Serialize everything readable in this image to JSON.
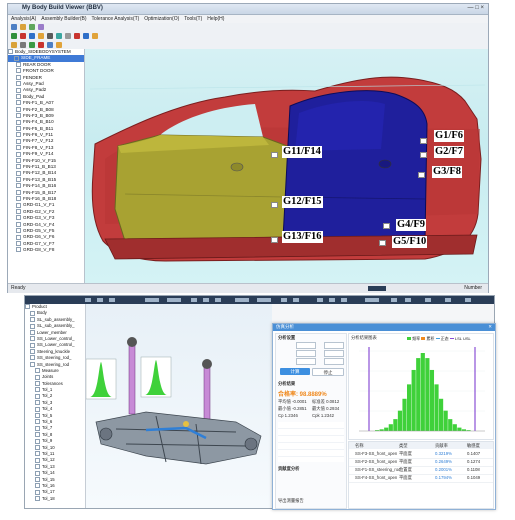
{
  "top_window": {
    "title": "My Body Build Viewer (BBV)",
    "window_controls": "— □ ×",
    "menu": [
      "Analysis(A)",
      "Assembly Builder(B)",
      "Tolerance Analysis(T)",
      "Optimization(O)",
      "Tools(T)",
      "Help(H)"
    ],
    "tree": {
      "root": "Body_SIDEBODYSYSTEM",
      "selected": "SIDE_FRAME",
      "items": [
        "REAR DOOR",
        "FRONT DOOR",
        "FENDER",
        "Assy_Pad",
        "Assy_Pad2",
        "Body_Pad",
        "FIN-F1_B_A07",
        "FIN-F2_B_B08",
        "FIN-F3_B_B09",
        "FIN-F4_B_B10",
        "FIN-F5_B_B11",
        "FIN-F6_V_F11",
        "FIN-F7_V_F12",
        "FIN-F8_V_F13",
        "FIN-F9_V_F14",
        "FIN-F10_V_F15",
        "FIN-F11_B_B13",
        "FIN-F12_B_B14",
        "FIN-F13_B_B15",
        "FIN-F14_B_B16",
        "FIN-F15_B_B17",
        "FIN-F16_B_B18",
        "GRD-G1_V_F1",
        "GRD-G2_V_F2",
        "GRD-G3_V_F3",
        "GRD-G4_V_F4",
        "GRD-G5_V_F5",
        "GRD-G6_V_F6",
        "GRD-G7_V_F7",
        "GRD-G8_V_F8"
      ]
    },
    "labels": [
      "G1/F6",
      "G2/F7",
      "G3/F8",
      "G4/F9",
      "G5/F10",
      "G11/F14",
      "G12/F15",
      "G13/F16"
    ],
    "status_left": "Ready",
    "status_right": "Number"
  },
  "bottom_window": {
    "tree": {
      "root": "Product",
      "items": [
        "Body",
        "SL_sub_assembly_",
        "SL_sub_assembly_",
        "Lower_member",
        "SS_Lower_control_",
        "SS_Lower_control_",
        "Steering_knuckle",
        "SS_steering_rod_",
        "SS_steering_rod",
        "Measure",
        "Joints",
        "Tolerances",
        "Tol_1",
        "Tol_2",
        "Tol_3",
        "Tol_4",
        "Tol_5",
        "Tol_6",
        "Tol_7",
        "Tol_8",
        "Tol_9",
        "Tol_10",
        "Tol_11",
        "Tol_12",
        "Tol_13",
        "Tol_14",
        "Tol_15",
        "Tol_16",
        "Tol_17",
        "Tol_18"
      ]
    },
    "dialog": {
      "title": "仿真分析",
      "section_settings": "分析设置",
      "run_button": "计算",
      "stop_button": "停止",
      "result_title": "分析结果",
      "result_value": "合格率: 98.8889%",
      "stats": [
        "平均值 -0.0001",
        "标准差 0.0812",
        "最小值 -0.2851",
        "最大值 0.2934",
        "Cp 1.2346",
        "Cpk 1.2342"
      ],
      "section_contrib": "贡献度分析",
      "chart_tab": "分析结果图表",
      "legend": [
        "频率",
        "累积",
        "正态",
        "LSL",
        "USL"
      ],
      "table_headers": [
        "名称",
        "类型",
        "贡献率",
        "敏感度"
      ],
      "table_rows": [
        [
          "SS-F3-SS_front_open",
          "平面度",
          "0.3219%",
          "0.1407"
        ],
        [
          "SS-F2-SS_front_open",
          "平面度",
          "0.2649%",
          "0.1274"
        ],
        [
          "SS-F1-SS_steering_rod",
          "位置度",
          "0.2001%",
          "0.1108"
        ],
        [
          "SS-F4-SS_front_open",
          "平面度",
          "0.1794%",
          "0.1049"
        ]
      ],
      "footer": "导出测量报告"
    },
    "chart_data": {
      "type": "bar",
      "x": [
        -0.3,
        -0.27,
        -0.24,
        -0.21,
        -0.18,
        -0.15,
        -0.12,
        -0.09,
        -0.06,
        -0.03,
        0,
        0.03,
        0.06,
        0.09,
        0.12,
        0.15,
        0.18,
        0.21,
        0.24,
        0.27,
        0.3
      ],
      "values": [
        1,
        2,
        4,
        8,
        14,
        24,
        38,
        55,
        72,
        86,
        92,
        86,
        72,
        55,
        38,
        24,
        14,
        8,
        4,
        2,
        1
      ],
      "title": "",
      "xlabel": "",
      "ylabel": "",
      "colors": {
        "bars": "#3fd13a",
        "limits": "#8a4fd6"
      }
    }
  }
}
